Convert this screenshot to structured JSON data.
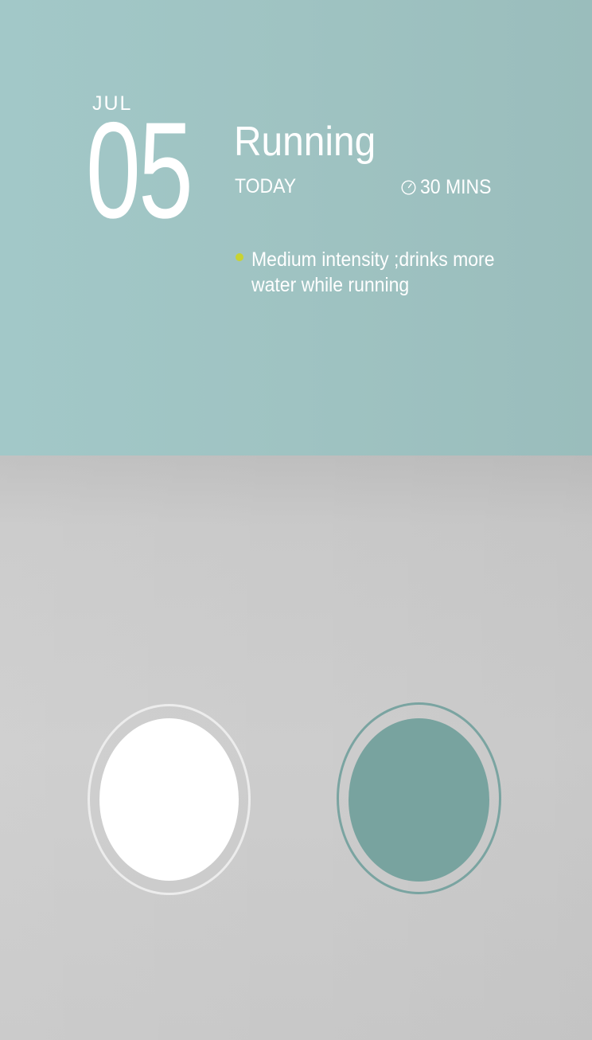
{
  "event": {
    "month": "JUL",
    "day": "05",
    "title": "Running",
    "when": "TODAY",
    "duration": "30 MINS",
    "duration_icon": "timer-icon",
    "note": "Medium intensity ;drinks more water while running",
    "note_bullet_color": "#c8d332"
  },
  "colors": {
    "top_panel": "#9fc3c2",
    "bottom_panel": "#cbcbcb",
    "white_option": "#ffffff",
    "teal_option": "#78a39f"
  },
  "options": [
    {
      "name": "white-color-option",
      "color": "#ffffff",
      "selected": false
    },
    {
      "name": "teal-color-option",
      "color": "#78a39f",
      "selected": true
    }
  ]
}
